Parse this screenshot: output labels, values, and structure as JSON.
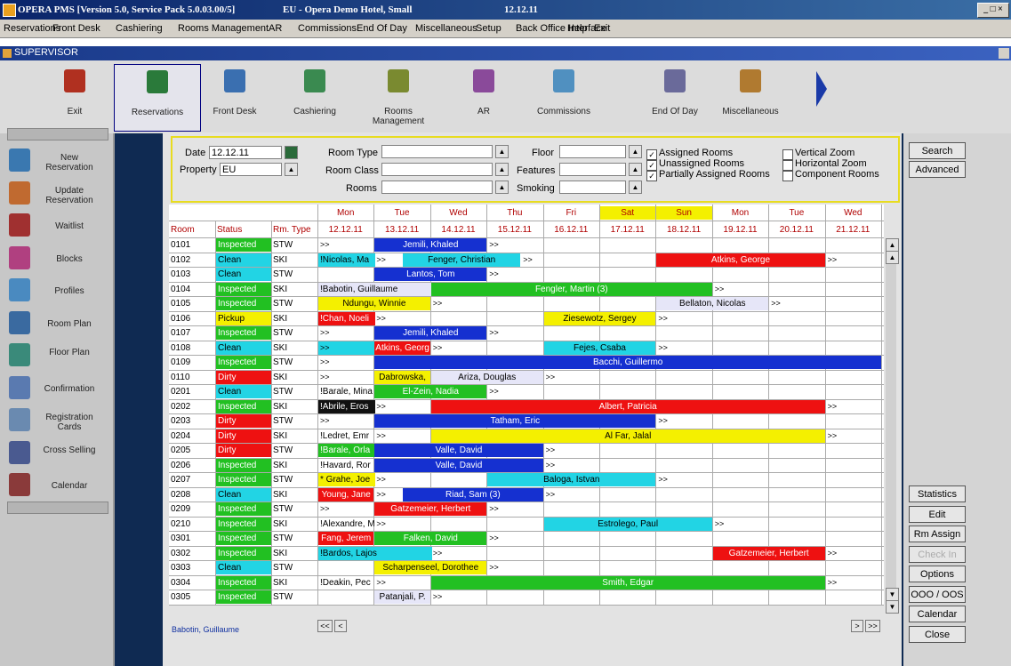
{
  "window": {
    "title": "OPERA PMS [Version 5.0, Service Pack 5.0.03.00/5]",
    "hotel": "EU - Opera Demo Hotel, Small",
    "date": "12.12.11",
    "controls": "_ □ ×"
  },
  "menu": [
    "Reservations",
    "Front Desk",
    "Cashiering",
    "Rooms Management",
    "AR",
    "Commissions",
    "End Of Day",
    "Miscellaneous",
    "Setup",
    "Back Office Interface",
    "Help",
    "Exit"
  ],
  "user_bar": {
    "label": "SUPERVISOR"
  },
  "toolbar": [
    {
      "label": "Exit",
      "icon": "exit-icon",
      "color": "#b03020"
    },
    {
      "label": "Reservations",
      "icon": "reservations-icon",
      "color": "#2a7a3a"
    },
    {
      "label": "Front Desk",
      "icon": "front-desk-icon",
      "color": "#3a6fb0"
    },
    {
      "label": "Cashiering",
      "icon": "cashiering-icon",
      "color": "#3a8a50"
    },
    {
      "label": "Rooms Management",
      "icon": "rooms-management-icon",
      "color": "#7a8a30"
    },
    {
      "label": "AR",
      "icon": "ar-icon",
      "color": "#8a4a9a"
    },
    {
      "label": "Commissions",
      "icon": "commissions-icon",
      "color": "#5090c0"
    },
    {
      "label": "End Of Day",
      "icon": "end-of-day-icon",
      "color": "#6a6a9a"
    },
    {
      "label": "Miscellaneous",
      "icon": "miscellaneous-icon",
      "color": "#b07a30"
    }
  ],
  "left_panel": [
    {
      "label": "New Reservation",
      "icon": "new-reservation-icon",
      "color": "#3a78b0"
    },
    {
      "label": "Update Reservation",
      "icon": "update-reservation-icon",
      "color": "#c06a30"
    },
    {
      "label": "Waitlist",
      "icon": "waitlist-icon",
      "color": "#a03030"
    },
    {
      "label": "Blocks",
      "icon": "blocks-icon",
      "color": "#b04080"
    },
    {
      "label": "Profiles",
      "icon": "profiles-icon",
      "color": "#4a8ac0"
    },
    {
      "label": "Room Plan",
      "icon": "room-plan-icon",
      "color": "#3a6aa0"
    },
    {
      "label": "Floor Plan",
      "icon": "floor-plan-icon",
      "color": "#3a8a7a"
    },
    {
      "label": "Confirmation",
      "icon": "confirmation-icon",
      "color": "#5a7ab0"
    },
    {
      "label": "Registration Cards",
      "icon": "registration-cards-icon",
      "color": "#6a8ab0"
    },
    {
      "label": "Cross Selling",
      "icon": "cross-selling-icon",
      "color": "#4a5a90"
    },
    {
      "label": "Calendar",
      "icon": "calendar-icon",
      "color": "#8a3a3a"
    }
  ],
  "search": {
    "date_label": "Date",
    "date_value": "12.12.11",
    "property_label": "Property",
    "property_value": "EU",
    "room_type_label": "Room Type",
    "room_class_label": "Room Class",
    "rooms_label": "Rooms",
    "floor_label": "Floor",
    "features_label": "Features",
    "smoking_label": "Smoking",
    "checks": [
      {
        "label": "Assigned Rooms",
        "checked": true
      },
      {
        "label": "Unassigned Rooms",
        "checked": true
      },
      {
        "label": "Partially Assigned Rooms",
        "checked": true
      },
      {
        "label": "Vertical Zoom",
        "checked": false
      },
      {
        "label": "Horizontal Zoom",
        "checked": false
      },
      {
        "label": "Component Rooms",
        "checked": false
      }
    ]
  },
  "grid": {
    "col_headers": [
      "Room",
      "Status",
      "Rm. Type"
    ],
    "days": [
      {
        "dow": "Mon",
        "date": "12.12.11",
        "weekend": false
      },
      {
        "dow": "Tue",
        "date": "13.12.11",
        "weekend": false
      },
      {
        "dow": "Wed",
        "date": "14.12.11",
        "weekend": false
      },
      {
        "dow": "Thu",
        "date": "15.12.11",
        "weekend": false
      },
      {
        "dow": "Fri",
        "date": "16.12.11",
        "weekend": false
      },
      {
        "dow": "Sat",
        "date": "17.12.11",
        "weekend": true
      },
      {
        "dow": "Sun",
        "date": "18.12.11",
        "weekend": true
      },
      {
        "dow": "Mon",
        "date": "19.12.11",
        "weekend": false
      },
      {
        "dow": "Tue",
        "date": "20.12.11",
        "weekend": false
      },
      {
        "dow": "Wed",
        "date": "21.12.11",
        "weekend": false
      }
    ],
    "status_colors": {
      "Inspected": "#22c022",
      "Clean": "#22d4e4",
      "Dirty": "#ee1111",
      "Pickup": "#f4f000"
    },
    "rows": [
      {
        "room": "0101",
        "status": "Inspected",
        "type": "STW",
        "res": [
          {
            "s": 0,
            "e": 1,
            "name": ">>",
            "color": ""
          },
          {
            "s": 1,
            "e": 3,
            "name": "Jemili, Khaled",
            "color": "#1530d0"
          },
          {
            "s": 3,
            "e": 4,
            "name": ">>",
            "color": ""
          }
        ]
      },
      {
        "room": "0102",
        "status": "Clean",
        "type": "SKI",
        "res": [
          {
            "s": 0,
            "e": 1,
            "name": "!Nicolas, Ma",
            "color": "#22d4e4"
          },
          {
            "s": 1,
            "e": 2,
            "name": ">>",
            "color": ""
          },
          {
            "s": 1.5,
            "e": 3.6,
            "name": "Fenger, Christian",
            "color": "#22d4e4"
          },
          {
            "s": 3.6,
            "e": 4,
            "name": ">>",
            "color": ""
          },
          {
            "s": 6,
            "e": 9,
            "name": "Atkins, George",
            "color": "#ee1111"
          },
          {
            "s": 9,
            "e": 10,
            "name": ">>",
            "color": ""
          }
        ]
      },
      {
        "room": "0103",
        "status": "Clean",
        "type": "STW",
        "res": [
          {
            "s": 1,
            "e": 3,
            "name": "Lantos, Tom",
            "color": "#1530d0"
          },
          {
            "s": 3,
            "e": 4,
            "name": ">>",
            "color": ""
          }
        ]
      },
      {
        "room": "0104",
        "status": "Inspected",
        "type": "SKI",
        "res": [
          {
            "s": 0,
            "e": 2,
            "name": "!Babotin, Guillaume",
            "color": "#e6e6f8"
          },
          {
            "s": 2,
            "e": 7,
            "name": "Fengler, Martin (3)",
            "color": "#22c022"
          },
          {
            "s": 7,
            "e": 8,
            "name": ">>",
            "color": ""
          }
        ]
      },
      {
        "room": "0105",
        "status": "Inspected",
        "type": "STW",
        "res": [
          {
            "s": 0,
            "e": 2,
            "name": "Ndungu, Winnie",
            "color": "#f4f000"
          },
          {
            "s": 2,
            "e": 3,
            "name": ">>",
            "color": ""
          },
          {
            "s": 6,
            "e": 8,
            "name": "Bellaton, Nicolas",
            "color": "#e6e6f8"
          },
          {
            "s": 8,
            "e": 9,
            "name": ">>",
            "color": ""
          }
        ]
      },
      {
        "room": "0106",
        "status": "Pickup",
        "type": "SKI",
        "res": [
          {
            "s": 0,
            "e": 1,
            "name": "!Chan, Noeli",
            "color": "#ee1111"
          },
          {
            "s": 1,
            "e": 2,
            "name": ">>",
            "color": ""
          },
          {
            "s": 4,
            "e": 6,
            "name": "Ziesewotz, Sergey",
            "color": "#f4f000"
          },
          {
            "s": 6,
            "e": 7,
            "name": ">>",
            "color": ""
          }
        ]
      },
      {
        "room": "0107",
        "status": "Inspected",
        "type": "STW",
        "res": [
          {
            "s": 0,
            "e": 1,
            "name": ">>",
            "color": ""
          },
          {
            "s": 1,
            "e": 3,
            "name": "Jemili, Khaled",
            "color": "#1530d0"
          },
          {
            "s": 3,
            "e": 4,
            "name": ">>",
            "color": ""
          }
        ]
      },
      {
        "room": "0108",
        "status": "Clean",
        "type": "SKI",
        "res": [
          {
            "s": 0,
            "e": 1,
            "name": ">>",
            "color": "#22d4e4"
          },
          {
            "s": 1,
            "e": 2,
            "name": "Atkins, Georg",
            "color": "#ee1111"
          },
          {
            "s": 2,
            "e": 3,
            "name": ">>",
            "color": ""
          },
          {
            "s": 4,
            "e": 6,
            "name": "Fejes, Csaba",
            "color": "#22d4e4"
          },
          {
            "s": 6,
            "e": 7,
            "name": ">>",
            "color": ""
          }
        ]
      },
      {
        "room": "0109",
        "status": "Inspected",
        "type": "STW",
        "res": [
          {
            "s": 0,
            "e": 1,
            "name": ">>",
            "color": ""
          },
          {
            "s": 1,
            "e": 10,
            "name": "Bacchi, Guillermo",
            "color": "#1530d0"
          }
        ]
      },
      {
        "room": "0110",
        "status": "Dirty",
        "type": "SKI",
        "res": [
          {
            "s": 0,
            "e": 1,
            "name": ">>",
            "color": ""
          },
          {
            "s": 1,
            "e": 2,
            "name": "Dabrowska,",
            "color": "#f4f000"
          },
          {
            "s": 2,
            "e": 4,
            "name": "Ariza, Douglas",
            "color": "#e6e6f8"
          },
          {
            "s": 4,
            "e": 5,
            "name": ">>",
            "color": ""
          }
        ]
      },
      {
        "room": "0201",
        "status": "Clean",
        "type": "STW",
        "res": [
          {
            "s": 0,
            "e": 1,
            "name": "!Barale, Mina",
            "color": ""
          },
          {
            "s": 1,
            "e": 3,
            "name": "El-Zein, Nadia",
            "color": "#22c022"
          },
          {
            "s": 3,
            "e": 4,
            "name": ">>",
            "color": ""
          }
        ]
      },
      {
        "room": "0202",
        "status": "Inspected",
        "type": "SKI",
        "res": [
          {
            "s": 0,
            "e": 1,
            "name": "!Abrile, Eros",
            "color": "#111"
          },
          {
            "s": 1,
            "e": 2,
            "name": ">>",
            "color": ""
          },
          {
            "s": 2,
            "e": 9,
            "name": "Albert, Patricia",
            "color": "#ee1111"
          },
          {
            "s": 9,
            "e": 10,
            "name": ">>",
            "color": ""
          }
        ]
      },
      {
        "room": "0203",
        "status": "Dirty",
        "type": "STW",
        "res": [
          {
            "s": 0,
            "e": 1,
            "name": ">>",
            "color": ""
          },
          {
            "s": 1,
            "e": 6,
            "name": "Tatham, Eric",
            "color": "#1530d0"
          },
          {
            "s": 6,
            "e": 7,
            "name": ">>",
            "color": ""
          }
        ]
      },
      {
        "room": "0204",
        "status": "Dirty",
        "type": "SKI",
        "res": [
          {
            "s": 0,
            "e": 1,
            "name": "!Ledret, Emr",
            "color": ""
          },
          {
            "s": 1,
            "e": 2,
            "name": ">>",
            "color": ""
          },
          {
            "s": 2,
            "e": 9,
            "name": "Al Far, Jalal",
            "color": "#f4f000"
          },
          {
            "s": 9,
            "e": 10,
            "name": ">>",
            "color": ""
          }
        ]
      },
      {
        "room": "0205",
        "status": "Dirty",
        "type": "STW",
        "res": [
          {
            "s": 0,
            "e": 1,
            "name": "!Barale, Orla",
            "color": "#22c022"
          },
          {
            "s": 1,
            "e": 4,
            "name": "Valle, David",
            "color": "#1530d0"
          },
          {
            "s": 4,
            "e": 5,
            "name": ">>",
            "color": ""
          }
        ]
      },
      {
        "room": "0206",
        "status": "Inspected",
        "type": "SKI",
        "res": [
          {
            "s": 0,
            "e": 1,
            "name": "!Havard, Ror",
            "color": ""
          },
          {
            "s": 1,
            "e": 4,
            "name": "Valle, David",
            "color": "#1530d0"
          },
          {
            "s": 4,
            "e": 5,
            "name": ">>",
            "color": ""
          }
        ]
      },
      {
        "room": "0207",
        "status": "Inspected",
        "type": "STW",
        "res": [
          {
            "s": 0,
            "e": 1,
            "name": "* Grahe, Joe",
            "color": "#f4f000"
          },
          {
            "s": 1,
            "e": 2,
            "name": ">>",
            "color": ""
          },
          {
            "s": 3,
            "e": 6,
            "name": "Baloga, Istvan",
            "color": "#22d4e4"
          },
          {
            "s": 6,
            "e": 7,
            "name": ">>",
            "color": ""
          }
        ]
      },
      {
        "room": "0208",
        "status": "Clean",
        "type": "SKI",
        "res": [
          {
            "s": 0,
            "e": 1,
            "name": "Young, Jane",
            "color": "#ee1111"
          },
          {
            "s": 1,
            "e": 2,
            "name": ">>",
            "color": ""
          },
          {
            "s": 1.5,
            "e": 4,
            "name": "Riad, Sam (3)",
            "color": "#1530d0"
          },
          {
            "s": 4,
            "e": 5,
            "name": ">>",
            "color": ""
          }
        ]
      },
      {
        "room": "0209",
        "status": "Inspected",
        "type": "STW",
        "res": [
          {
            "s": 0,
            "e": 1,
            "name": ">>",
            "color": ""
          },
          {
            "s": 1,
            "e": 3,
            "name": "Gatzemeier, Herbert",
            "color": "#ee1111"
          },
          {
            "s": 3,
            "e": 4,
            "name": ">>",
            "color": ""
          }
        ]
      },
      {
        "room": "0210",
        "status": "Inspected",
        "type": "SKI",
        "res": [
          {
            "s": 0,
            "e": 1,
            "name": "!Alexandre, M",
            "color": ""
          },
          {
            "s": 1,
            "e": 2,
            "name": ">>",
            "color": ""
          },
          {
            "s": 4,
            "e": 7,
            "name": "Estrolego, Paul",
            "color": "#22d4e4"
          },
          {
            "s": 7,
            "e": 8,
            "name": ">>",
            "color": ""
          }
        ]
      },
      {
        "room": "0301",
        "status": "Inspected",
        "type": "STW",
        "res": [
          {
            "s": 0,
            "e": 1,
            "name": "Fang, Jerem",
            "color": "#ee1111"
          },
          {
            "s": 1,
            "e": 3,
            "name": "Falken, David",
            "color": "#22c022"
          },
          {
            "s": 3,
            "e": 4,
            "name": ">>",
            "color": ""
          }
        ]
      },
      {
        "room": "0302",
        "status": "Inspected",
        "type": "SKI",
        "res": [
          {
            "s": 0,
            "e": 2,
            "name": "!Bardos, Lajos",
            "color": "#22d4e4"
          },
          {
            "s": 2,
            "e": 3,
            "name": ">>",
            "color": ""
          },
          {
            "s": 7,
            "e": 9,
            "name": "Gatzemeier, Herbert",
            "color": "#ee1111"
          },
          {
            "s": 9,
            "e": 10,
            "name": ">>",
            "color": ""
          }
        ]
      },
      {
        "room": "0303",
        "status": "Clean",
        "type": "STW",
        "res": [
          {
            "s": 1,
            "e": 3,
            "name": "Scharpenseel, Dorothee",
            "color": "#f4f000"
          },
          {
            "s": 3,
            "e": 4,
            "name": ">>",
            "color": ""
          }
        ]
      },
      {
        "room": "0304",
        "status": "Inspected",
        "type": "SKI",
        "res": [
          {
            "s": 0,
            "e": 1,
            "name": "!Deakin, Pec",
            "color": ""
          },
          {
            "s": 1,
            "e": 2,
            "name": ">>",
            "color": ""
          },
          {
            "s": 2,
            "e": 9,
            "name": "Smith, Edgar",
            "color": "#22c022"
          },
          {
            "s": 9,
            "e": 10,
            "name": ">>",
            "color": ""
          }
        ]
      },
      {
        "room": "0305",
        "status": "Inspected",
        "type": "STW",
        "res": [
          {
            "s": 1,
            "e": 2,
            "name": "Patanjali, P.",
            "color": "#e6e6f8"
          },
          {
            "s": 2,
            "e": 3,
            "name": ">>",
            "color": ""
          }
        ]
      }
    ]
  },
  "footer": {
    "selected_name": "Babotin, Guillaume",
    "nav_first": "<<",
    "nav_prev": "<",
    "nav_next": ">",
    "nav_last": ">>"
  },
  "right_buttons_top": [
    "Search",
    "Advanced"
  ],
  "right_buttons_bottom": [
    {
      "label": "Statistics",
      "enabled": true
    },
    {
      "label": "Edit",
      "enabled": true
    },
    {
      "label": "Rm Assign",
      "enabled": true
    },
    {
      "label": "Check In",
      "enabled": false
    },
    {
      "label": "Options",
      "enabled": true
    },
    {
      "label": "OOO / OOS",
      "enabled": true
    },
    {
      "label": "Calendar",
      "enabled": true
    },
    {
      "label": "Close",
      "enabled": true
    }
  ]
}
